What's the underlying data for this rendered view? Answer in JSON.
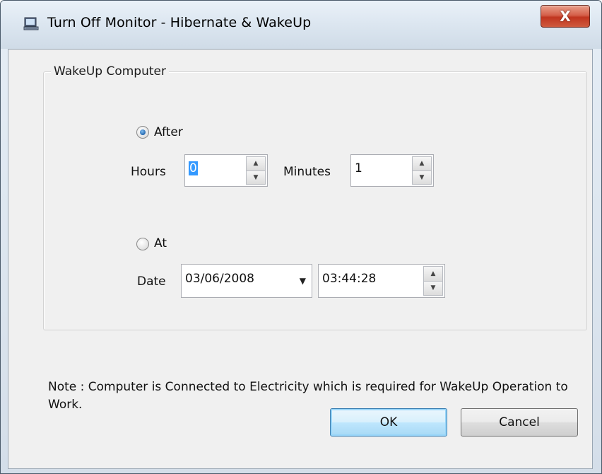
{
  "window": {
    "title": "Turn Off Monitor - Hibernate & WakeUp",
    "close_label": "X"
  },
  "group": {
    "legend": "WakeUp Computer",
    "after_label": "After",
    "after_checked": true,
    "hours_label": "Hours",
    "hours_value": "0",
    "minutes_label": "Minutes",
    "minutes_value": "1",
    "at_label": "At",
    "at_checked": false,
    "date_label": "Date",
    "date_value": "03/06/2008",
    "time_value": "03:44:28"
  },
  "note": "Note : Computer is Connected to Electricity which is required for WakeUp Operation to Work.",
  "buttons": {
    "ok_label": "OK",
    "cancel_label": "Cancel"
  },
  "icons": {
    "app": "monitor-icon",
    "close": "close-icon",
    "spin_up": "arrow-up-icon",
    "spin_down": "arrow-down-icon",
    "dropdown": "chevron-down-icon"
  }
}
